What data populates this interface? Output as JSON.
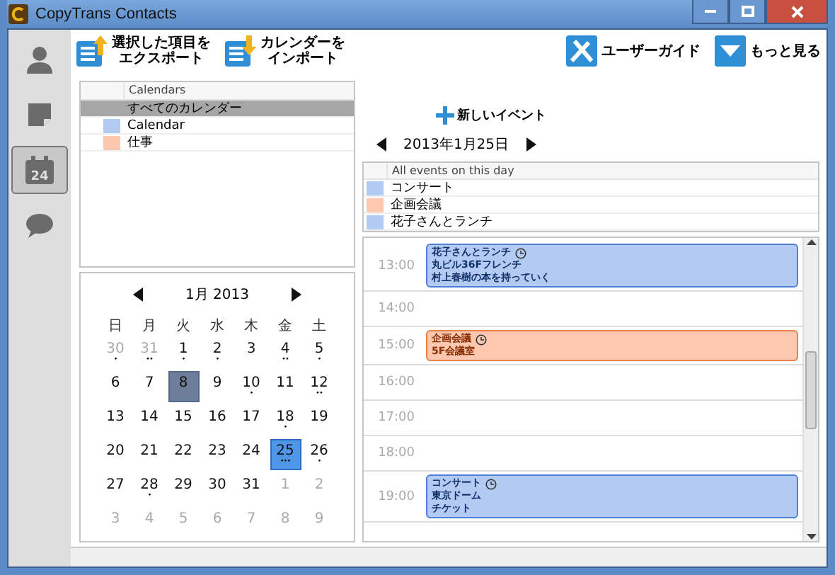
{
  "window": {
    "title": "CopyTrans Contacts"
  },
  "sidebar": {
    "items": [
      {
        "kind": "contacts",
        "selected": false
      },
      {
        "kind": "notes",
        "selected": false
      },
      {
        "kind": "calendar",
        "selected": true,
        "label": "24"
      },
      {
        "kind": "messages",
        "selected": false
      }
    ]
  },
  "toolbar": {
    "left": [
      {
        "kind": "export",
        "lines": [
          "選択した項目を",
          "エクスポート"
        ]
      },
      {
        "kind": "import",
        "lines": [
          "カレンダーを",
          "インポート"
        ]
      }
    ],
    "right": [
      {
        "kind": "guide",
        "label": "ユーザーガイド"
      },
      {
        "kind": "more",
        "label": "もっと見る"
      }
    ]
  },
  "calendars": {
    "header": "Calendars",
    "rows": [
      {
        "name": "すべてのカレンダー",
        "selected": true
      },
      {
        "name": "Calendar",
        "color": "#b3cbf2",
        "selected": false
      },
      {
        "name": "仕事",
        "color": "#fcc8b0",
        "selected": false
      }
    ]
  },
  "mini_calendar": {
    "month": "1月 2013",
    "weekdays": [
      "日",
      "月",
      "火",
      "水",
      "木",
      "金",
      "土"
    ],
    "days": [
      {
        "d": "30",
        "muted": true,
        "dots": "•"
      },
      {
        "d": "31",
        "muted": true,
        "dots": "••"
      },
      {
        "d": "1",
        "dots": "•"
      },
      {
        "d": "2",
        "dots": "•"
      },
      {
        "d": "3"
      },
      {
        "d": "4",
        "dots": "••"
      },
      {
        "d": "5",
        "dots": "•"
      },
      {
        "d": "6"
      },
      {
        "d": "7"
      },
      {
        "d": "8",
        "today": true
      },
      {
        "d": "9"
      },
      {
        "d": "10",
        "dots": "•"
      },
      {
        "d": "11"
      },
      {
        "d": "12",
        "dots": "••"
      },
      {
        "d": "13"
      },
      {
        "d": "14"
      },
      {
        "d": "15"
      },
      {
        "d": "16"
      },
      {
        "d": "17"
      },
      {
        "d": "18",
        "dots": "•"
      },
      {
        "d": "19"
      },
      {
        "d": "20"
      },
      {
        "d": "21"
      },
      {
        "d": "22"
      },
      {
        "d": "23"
      },
      {
        "d": "24"
      },
      {
        "d": "25",
        "selected": true,
        "dots": "•••"
      },
      {
        "d": "26",
        "dots": "•"
      },
      {
        "d": "27"
      },
      {
        "d": "28",
        "dots": "•"
      },
      {
        "d": "29"
      },
      {
        "d": "30"
      },
      {
        "d": "31"
      },
      {
        "d": "1",
        "muted": true
      },
      {
        "d": "2",
        "muted": true
      },
      {
        "d": "3",
        "muted": true
      },
      {
        "d": "4",
        "muted": true
      },
      {
        "d": "5",
        "muted": true
      },
      {
        "d": "6",
        "muted": true
      },
      {
        "d": "7",
        "muted": true
      },
      {
        "d": "8",
        "muted": true
      },
      {
        "d": "9",
        "muted": true
      }
    ]
  },
  "new_event": "新しいイベント",
  "date": "2013年1月25日",
  "events_list": {
    "header": "All events on this day",
    "rows": [
      {
        "name": "コンサート",
        "color": "#b3cbf2"
      },
      {
        "name": "企画会議",
        "color": "#fcc8b0"
      },
      {
        "name": "花子さんとランチ",
        "color": "#b3cbf2"
      }
    ]
  },
  "timeline": [
    {
      "time": "13:00",
      "event": {
        "color": "#b3cbf2",
        "lines": [
          "花子さんとランチ",
          "丸ビル36Fフレンチ",
          "村上春樹の本を持っていく"
        ]
      }
    },
    {
      "time": "14:00"
    },
    {
      "time": "15:00",
      "event": {
        "color": "#fcc8b0",
        "lines": [
          "企画会議",
          "5F会議室"
        ]
      }
    },
    {
      "time": "16:00"
    },
    {
      "time": "17:00"
    },
    {
      "time": "18:00"
    },
    {
      "time": "19:00",
      "event": {
        "color": "#b3cbf2",
        "lines": [
          "コンサート",
          "東京ドーム",
          "チケット"
        ]
      }
    }
  ]
}
